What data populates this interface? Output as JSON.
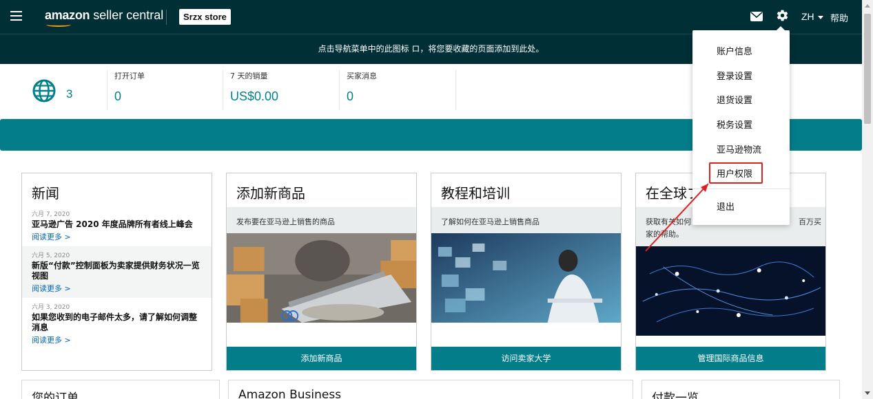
{
  "header": {
    "logo_brand": "amazon",
    "logo_product": " seller central",
    "store_name": "Srzx store",
    "language": "ZH",
    "help": "帮助",
    "bar_color": "#002f36"
  },
  "hint": {
    "text": "点击导航菜单中的此图标 ロ，将您要收藏的页面添加到此处。"
  },
  "stats": {
    "globe_count": "3",
    "items": [
      {
        "label": "打开订单",
        "value": "0"
      },
      {
        "label": "7 天的销量",
        "value": "US$0.00"
      },
      {
        "label": "买家消息",
        "value": "0"
      }
    ]
  },
  "news": {
    "title": "新闻",
    "items": [
      {
        "date": "六月 7, 2020",
        "headline": "亚马逊广告 2020 年度品牌所有者线上峰会",
        "link": "阅读更多 >"
      },
      {
        "date": "六月 5, 2020",
        "headline": "新版“付款”控制面板为卖家提供财务状况一览视图",
        "link": "阅读更多 >"
      },
      {
        "date": "六月 3, 2020",
        "headline": "如果您收到的电子邮件太多，请了解如何调整消息",
        "link": "阅读更多 >"
      }
    ]
  },
  "cards": [
    {
      "title": "添加新商品",
      "desc": "发布要在亚马逊上销售的商品",
      "button": "添加新商品"
    },
    {
      "title": "教程和培训",
      "desc": "了解如何在亚马逊上销售商品",
      "button": "访问卖家大学"
    },
    {
      "title": "在全球ブ",
      "desc": "获取有关如何",
      "desc2": "百万买",
      "desc3": "家的帮助。",
      "button": "管理国际商品信息"
    }
  ],
  "bottom": {
    "orders": "您的订单",
    "business": "Amazon Business",
    "payments": "付款一览"
  },
  "dropdown": {
    "items": [
      "账户信息",
      "登录设置",
      "退货设置",
      "税务设置",
      "亚马逊物流",
      "用户权限",
      "退出"
    ]
  },
  "accent": "#047d8a"
}
